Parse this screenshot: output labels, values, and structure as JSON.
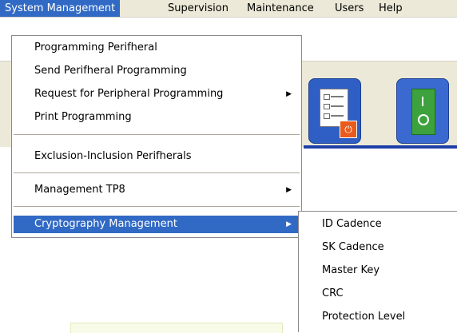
{
  "menubar": {
    "items": [
      {
        "label": "System Management",
        "active": true
      },
      {
        "label": "Supervision"
      },
      {
        "label": "Maintenance"
      },
      {
        "label": "Users"
      },
      {
        "label": "Help"
      }
    ]
  },
  "dropdown": {
    "items": [
      {
        "label": "Programming Perifheral",
        "submenu": false
      },
      {
        "label": "Send Perifheral Programming",
        "submenu": false
      },
      {
        "label": "Request for Peripheral Programming",
        "submenu": true
      },
      {
        "label": "Print Programming",
        "submenu": false
      },
      {
        "label": "Exclusion-Inclusion Perifherals",
        "submenu": false
      },
      {
        "label": "Management TP8",
        "submenu": true
      },
      {
        "label": "Cryptography Management",
        "submenu": true,
        "highlighted": true
      }
    ],
    "arrow_glyph": "▶"
  },
  "submenu": {
    "items": [
      {
        "label": "ID Cadence"
      },
      {
        "label": "SK Cadence"
      },
      {
        "label": "Master Key"
      },
      {
        "label": "CRC"
      },
      {
        "label": "Protection Level"
      }
    ]
  },
  "toolbar": {
    "buttons": [
      {
        "icon": "checklist-power-icon"
      },
      {
        "icon": "power-switch-icon"
      }
    ]
  },
  "colors": {
    "menu_highlight": "#316ac5",
    "menubar_bg": "#ece9d8",
    "toolbar_button": "#2f5fc4",
    "accent_line": "#1f3fa8"
  }
}
